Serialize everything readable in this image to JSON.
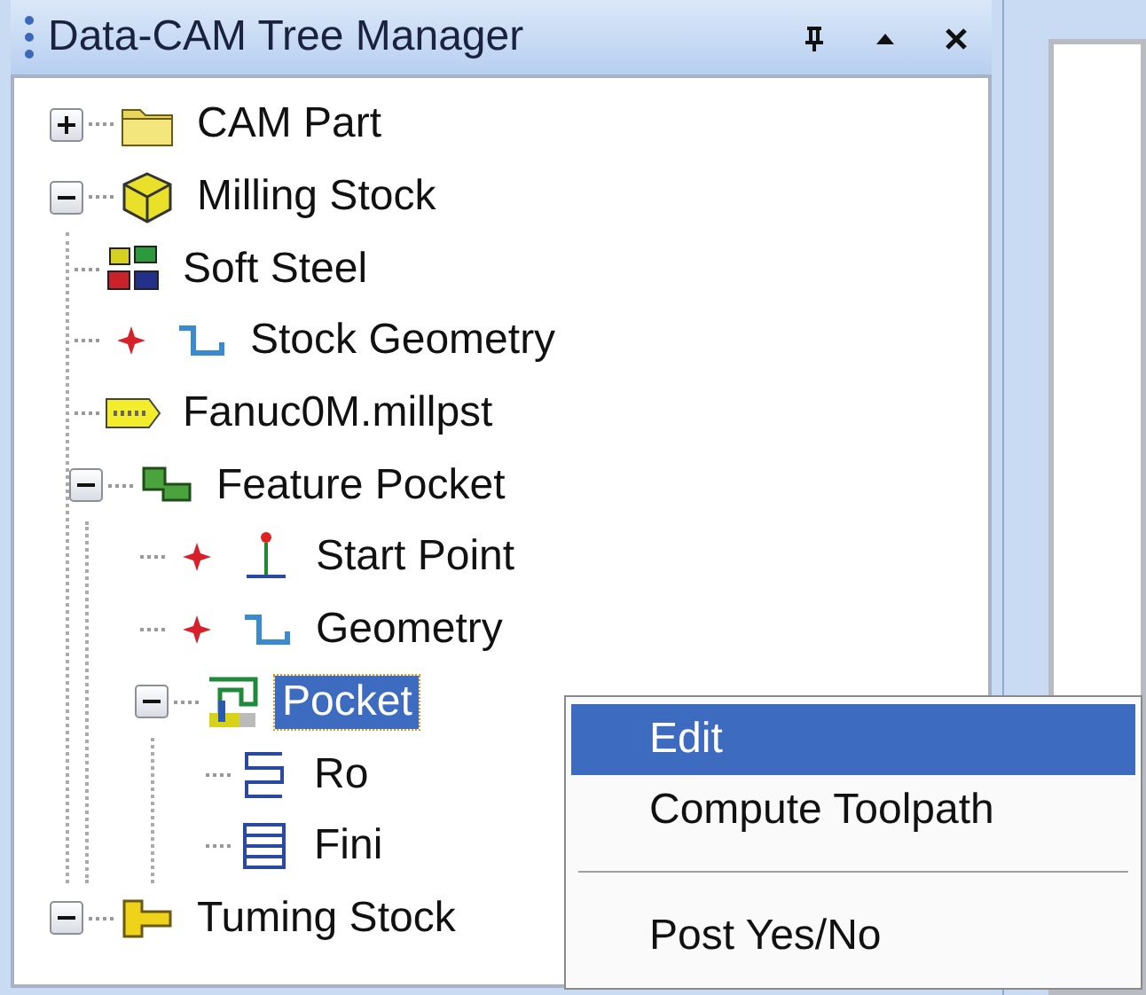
{
  "panel": {
    "title": "Data-CAM Tree Manager",
    "buttons": [
      {
        "kind": "pin"
      },
      {
        "kind": "up"
      },
      {
        "kind": "close"
      }
    ]
  },
  "tree": [
    {
      "label": "CAM Part",
      "kind": "folder",
      "expanded": false,
      "selected": false
    },
    {
      "label": "Milling Stock",
      "kind": "cube",
      "expanded": true,
      "selected": false,
      "children": [
        {
          "label": "Soft Steel",
          "kind": "material",
          "selected": false
        },
        {
          "label": "Stock Geometry",
          "kind": "geometry",
          "flagged": true,
          "selected": false
        },
        {
          "label": "Fanuc0M.millpst",
          "kind": "post",
          "selected": false
        },
        {
          "label": "Feature Pocket",
          "kind": "feature",
          "expanded": true,
          "selected": false,
          "children": [
            {
              "label": "Start Point",
              "kind": "startpoint",
              "flagged": true,
              "selected": false
            },
            {
              "label": "Geometry",
              "kind": "geometry",
              "flagged": true,
              "selected": false
            },
            {
              "label": "Pocket",
              "kind": "pocket",
              "expanded": true,
              "selected": true,
              "children": [
                {
                  "label": "Ro",
                  "kind": "roughing",
                  "selected": false
                },
                {
                  "label": "Fini",
                  "kind": "finishing",
                  "selected": false
                }
              ]
            }
          ]
        }
      ]
    },
    {
      "label": "Tuming Stock",
      "kind": "turning",
      "expanded": true,
      "selected": false
    }
  ],
  "context_menu": {
    "items": [
      {
        "kind": "item",
        "label": "Edit",
        "selected": true
      },
      {
        "kind": "item",
        "label": "Compute Toolpath",
        "selected": false
      },
      {
        "kind": "separator"
      },
      {
        "kind": "item",
        "label": "Post Yes/No",
        "selected": false
      }
    ]
  }
}
